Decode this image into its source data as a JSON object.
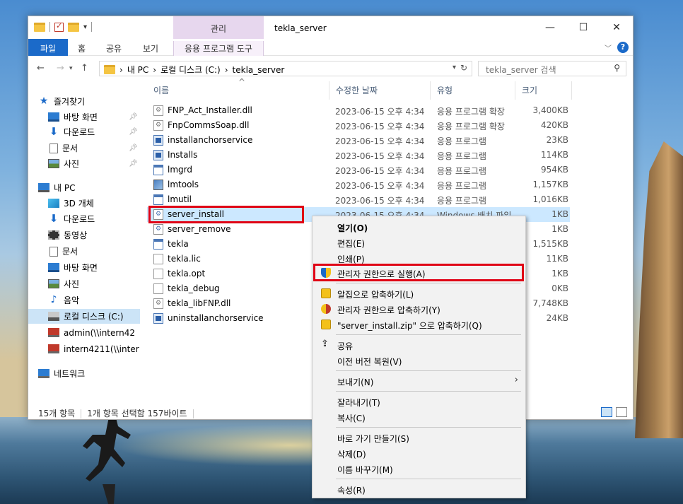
{
  "window": {
    "title": "tekla_server",
    "contextual_tab_group": "관리",
    "controls": {
      "minimize": "—",
      "maximize": "☐",
      "close": "✕"
    }
  },
  "ribbon": {
    "tabs": [
      "파일",
      "홈",
      "공유",
      "보기",
      "응용 프로그램 도구"
    ],
    "help": "?"
  },
  "address": {
    "back": "←",
    "forward": "→",
    "up": "↑",
    "crumbs": [
      "내 PC",
      "로컬 디스크 (C:)",
      "tekla_server"
    ],
    "search_placeholder": "tekla_server 검색"
  },
  "nav_pane": {
    "quick_access": "즐겨찾기",
    "quick_items": [
      "바탕 화면",
      "다운로드",
      "문서",
      "사진"
    ],
    "this_pc": "내 PC",
    "pc_items": [
      "3D 개체",
      "다운로드",
      "동영상",
      "문서",
      "바탕 화면",
      "사진",
      "음악",
      "로컬 디스크 (C:)"
    ],
    "net_drives": [
      "admin(\\\\intern42",
      "intern4211(\\\\inter"
    ],
    "network": "네트워크"
  },
  "columns": {
    "name": "이름",
    "date": "수정한 날짜",
    "type": "유형",
    "size": "크기"
  },
  "files": [
    {
      "name": "FNP_Act_Installer.dll",
      "date": "2023-06-15 오후 4:34",
      "type": "응용 프로그램 확장",
      "size": "3,400KB",
      "icon": "dll"
    },
    {
      "name": "FnpCommsSoap.dll",
      "date": "2023-06-15 오후 4:34",
      "type": "응용 프로그램 확장",
      "size": "420KB",
      "icon": "dll"
    },
    {
      "name": "installanchorservice",
      "date": "2023-06-15 오후 4:34",
      "type": "응용 프로그램",
      "size": "23KB",
      "icon": "exe"
    },
    {
      "name": "Installs",
      "date": "2023-06-15 오후 4:34",
      "type": "응용 프로그램",
      "size": "114KB",
      "icon": "exe"
    },
    {
      "name": "lmgrd",
      "date": "2023-06-15 오후 4:34",
      "type": "응용 프로그램",
      "size": "954KB",
      "icon": "app"
    },
    {
      "name": "lmtools",
      "date": "2023-06-15 오후 4:34",
      "type": "응용 프로그램",
      "size": "1,157KB",
      "icon": "img"
    },
    {
      "name": "lmutil",
      "date": "2023-06-15 오후 4:34",
      "type": "응용 프로그램",
      "size": "1,016KB",
      "icon": "app"
    },
    {
      "name": "server_install",
      "date": "2023-06-15 오후 4:34",
      "type": "Windows 배치 파일",
      "size": "1KB",
      "icon": "bat"
    },
    {
      "name": "server_remove",
      "date": "",
      "type": "",
      "size": "1KB",
      "icon": "bat"
    },
    {
      "name": "tekla",
      "date": "",
      "type": "",
      "size": "1,515KB",
      "icon": "app"
    },
    {
      "name": "tekla.lic",
      "date": "",
      "type": "",
      "size": "11KB",
      "icon": "txt"
    },
    {
      "name": "tekla.opt",
      "date": "",
      "type": "",
      "size": "1KB",
      "icon": "txt"
    },
    {
      "name": "tekla_debug",
      "date": "",
      "type": "",
      "size": "0KB",
      "icon": "txt"
    },
    {
      "name": "tekla_libFNP.dll",
      "date": "",
      "type": "",
      "size": "7,748KB",
      "icon": "dll"
    },
    {
      "name": "uninstallanchorservice",
      "date": "",
      "type": "",
      "size": "24KB",
      "icon": "exe"
    }
  ],
  "status": {
    "count": "15개 항목",
    "selected": "1개 항목 선택함 157바이트"
  },
  "context_menu": {
    "open": "열기(O)",
    "edit": "편집(E)",
    "print": "인쇄(P)",
    "run_as_admin": "관리자 권한으로 실행(A)",
    "zip_alzip": "알집으로 압축하기(L)",
    "zip_admin": "관리자 권한으로 압축하기(Y)",
    "zip_named": "\"server_install.zip\" 으로 압축하기(Q)",
    "share": "공유",
    "restore": "이전 버전 복원(V)",
    "send_to": "보내기(N)",
    "cut": "잘라내기(T)",
    "copy": "복사(C)",
    "shortcut": "바로 가기 만들기(S)",
    "delete": "삭제(D)",
    "rename": "이름 바꾸기(M)",
    "properties": "속성(R)"
  },
  "colors": {
    "accent": "#1b6ac9",
    "highlight": "#e00014",
    "selection": "#cce8ff"
  }
}
